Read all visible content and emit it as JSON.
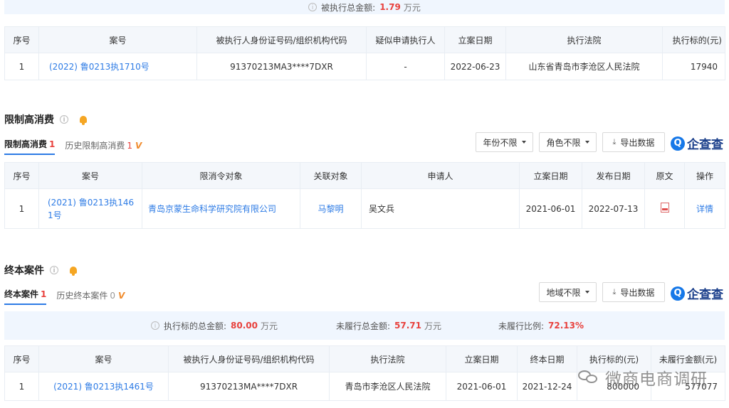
{
  "top_summary": {
    "label": "被执行总金额:",
    "value": "1.79",
    "unit": "万元"
  },
  "enforce_table": {
    "headers": [
      "序号",
      "案号",
      "被执行人身份证号码/组织机构代码",
      "疑似申请执行人",
      "立案日期",
      "执行法院",
      "执行标的(元)"
    ],
    "rows": [
      {
        "no": "1",
        "case": "(2022) 鲁0213执1710号",
        "id": "91370213MA3****7DXR",
        "applicant": "-",
        "date": "2022-06-23",
        "court": "山东省青岛市李沧区人民法院",
        "amount": "17940"
      }
    ]
  },
  "restrict_section": {
    "title": "限制高消费",
    "tab_active": "限制高消费",
    "tab_active_count": "1",
    "tab_history": "历史限制高消费",
    "tab_history_count": "1",
    "filter_year": "年份不限",
    "filter_role": "角色不限",
    "export": "导出数据",
    "logo_text": "企查查",
    "logo_mark": "Q",
    "headers": [
      "序号",
      "案号",
      "限消令对象",
      "关联对象",
      "申请人",
      "立案日期",
      "发布日期",
      "原文",
      "操作"
    ],
    "rows": [
      {
        "no": "1",
        "case": "(2021) 鲁0213执1461号",
        "target": "青岛京蒙生命科学研究院有限公司",
        "related": "马黎明",
        "applicant": "吴文兵",
        "date": "2021-06-01",
        "publish": "2022-07-13",
        "action": "详情"
      }
    ]
  },
  "final_section": {
    "title": "终本案件",
    "tab_active": "终本案件",
    "tab_active_count": "1",
    "tab_history": "历史终本案件",
    "tab_history_count": "0",
    "filter_region": "地域不限",
    "export": "导出数据",
    "logo_text": "企查查",
    "logo_mark": "Q",
    "summary": [
      {
        "label": "执行标的总金额:",
        "value": "80.00",
        "unit": "万元"
      },
      {
        "label": "未履行总金额:",
        "value": "57.71",
        "unit": "万元"
      },
      {
        "label": "未履行比例:",
        "value": "72.13%",
        "unit": ""
      }
    ],
    "headers": [
      "序号",
      "案号",
      "被执行人身份证号码/组织机构代码",
      "执行法院",
      "立案日期",
      "终本日期",
      "执行标的(元)",
      "未履行金额(元)"
    ],
    "rows": [
      {
        "no": "1",
        "case": "(2021) 鲁0213执1461号",
        "id": "91370213MA****7DXR",
        "court": "青岛市李沧区人民法院",
        "date": "2021-06-01",
        "end_date": "2021-12-24",
        "amount": "800000",
        "unpaid": "577077"
      }
    ]
  },
  "watermark": "微商电商调研",
  "vip_mark": "V",
  "colors": {
    "accent": "#2d7be5",
    "red": "#e8413d",
    "header_bg": "#f4f7fb",
    "summary_bg": "#f0f6fe"
  }
}
